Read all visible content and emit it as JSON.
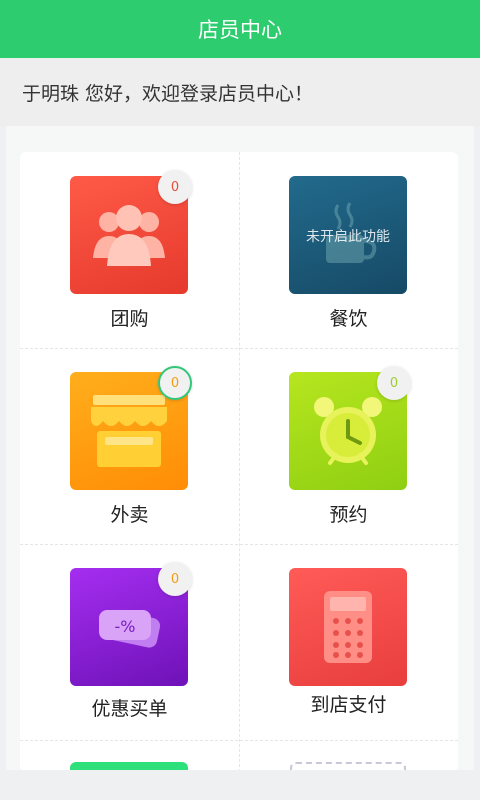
{
  "header": {
    "title": "店员中心"
  },
  "greeting": {
    "text": "于明珠 您好，欢迎登录店员中心！"
  },
  "tiles": [
    {
      "label": "团购",
      "badge": "0",
      "icon": "group-people-icon",
      "color": "#ef4a3c",
      "badge_color": "#e74c3c"
    },
    {
      "label": "餐饮",
      "badge": "",
      "icon": "coffee-cup-icon",
      "color": "#1d5b7c",
      "disabled_text": "未开启此功能"
    },
    {
      "label": "外卖",
      "badge": "0",
      "icon": "storefront-icon",
      "color": "#ff9c0f",
      "badge_color": "#f39c12"
    },
    {
      "label": "预约",
      "badge": "0",
      "icon": "alarm-clock-icon",
      "color": "#9fd81a",
      "badge_color": "#9acd32"
    },
    {
      "label": "优惠买单",
      "badge": "0",
      "icon": "discount-tag-icon",
      "color": "#8a1ed6",
      "badge_color": "#f39c12"
    },
    {
      "label": "到店支付",
      "badge": "",
      "icon": "calculator-icon",
      "color": "#f24747"
    }
  ]
}
